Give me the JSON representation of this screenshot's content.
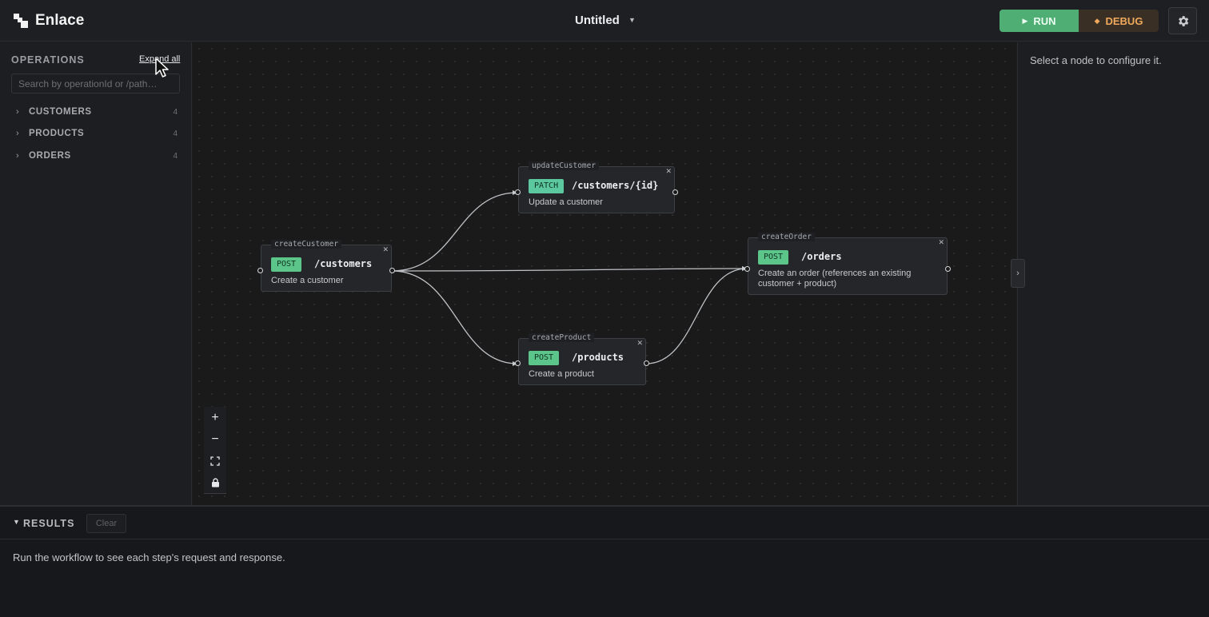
{
  "app": {
    "name": "Enlace"
  },
  "header": {
    "doc_title": "Untitled",
    "run_label": "RUN",
    "debug_label": "DEBUG",
    "icons": {
      "run": "play-icon",
      "debug": "diamond-icon",
      "settings": "gear-icon",
      "doc_menu": "caret-down-icon"
    }
  },
  "sidebar": {
    "title": "OPERATIONS",
    "expand_all": "Expand all",
    "search_placeholder": "Search by operationId or /path…",
    "groups": [
      {
        "label": "CUSTOMERS",
        "count": "4"
      },
      {
        "label": "PRODUCTS",
        "count": "4"
      },
      {
        "label": "ORDERS",
        "count": "4"
      }
    ]
  },
  "canvas": {
    "nodes": [
      {
        "id": "createCustomer",
        "method": "POST",
        "path": "/customers",
        "desc": "Create a customer"
      },
      {
        "id": "updateCustomer",
        "method": "PATCH",
        "path": "/customers/{id}",
        "desc": "Update a customer"
      },
      {
        "id": "createOrder",
        "method": "POST",
        "path": "/orders",
        "desc_line1": "Create an order (references an existing",
        "desc_line2": "customer + product)"
      },
      {
        "id": "createProduct",
        "method": "POST",
        "path": "/products",
        "desc": "Create a product"
      }
    ],
    "edges": [
      {
        "from": "createCustomer",
        "to": "updateCustomer"
      },
      {
        "from": "createCustomer",
        "to": "createOrder"
      },
      {
        "from": "createCustomer",
        "to": "createProduct"
      },
      {
        "from": "createProduct",
        "to": "createOrder"
      }
    ],
    "controls": [
      "zoom-in-icon",
      "zoom-out-icon",
      "fit-view-icon",
      "lock-icon"
    ]
  },
  "right_panel": {
    "hint": "Select a node to configure it."
  },
  "results": {
    "title": "RESULTS",
    "clear_label": "Clear",
    "empty_text": "Run the workflow to see each step's request and response."
  },
  "colors": {
    "run": "#4fae74",
    "debug_bg": "#3a2f24",
    "debug_text": "#f0a95c",
    "method_badge": "#5cc58a"
  }
}
